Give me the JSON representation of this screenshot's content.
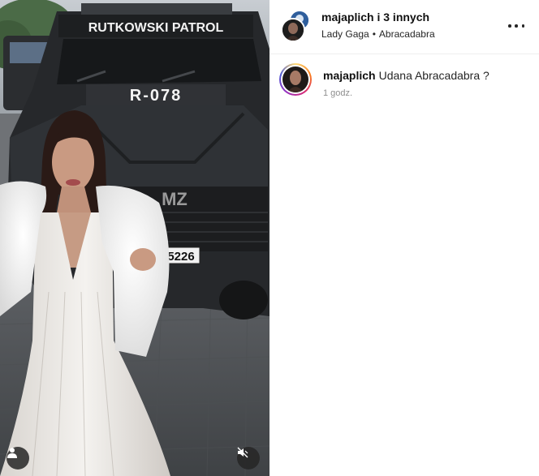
{
  "post": {
    "author": "majaplich i 3 innych",
    "music_artist": "Lady Gaga",
    "music_separator": "•",
    "music_track": "Abracadabra"
  },
  "media": {
    "vehicle_top_text": "RUTKOWSKI PATROL",
    "vehicle_plate_front": "R-078",
    "vehicle_brand": "MZ",
    "license_plate": "5226"
  },
  "caption": {
    "username": "majaplich",
    "text": "Udana Abracadabra ?",
    "time": "1 godz."
  },
  "icons": {
    "more": "more-options-icon",
    "user": "user-tag-icon",
    "mute": "audio-muted-icon"
  },
  "colors": {
    "story_ring": [
      "#feda75",
      "#fa7e1e",
      "#d62976",
      "#962fbf",
      "#4f5bd5"
    ],
    "meta_text": "#8e8e8e"
  }
}
